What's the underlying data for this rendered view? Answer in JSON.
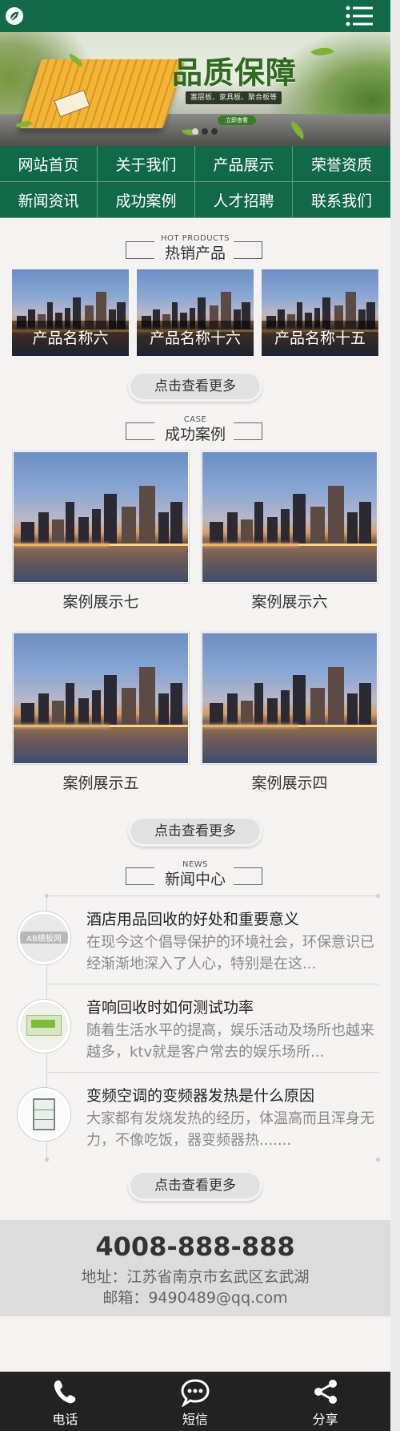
{
  "header": {
    "logo_icon": "leaf-logo-icon",
    "menu_icon": "menu-list-icon"
  },
  "banner": {
    "title": "品质保障",
    "subtitle": "塞层板、家具板、聚合板等",
    "button_label": "立即查看",
    "active_slide": 2,
    "slide_count": 3
  },
  "nav": {
    "items": [
      "网站首页",
      "关于我们",
      "产品展示",
      "荣誉资质",
      "新闻资讯",
      "成功案例",
      "人才招聘",
      "联系我们"
    ]
  },
  "hot_products": {
    "heading_en": "HOT PRODUCTS",
    "heading": "热销产品",
    "items": [
      "产品名称六",
      "产品名称十六",
      "产品名称十五"
    ],
    "more_label": "点击查看更多"
  },
  "cases": {
    "heading_en": "CASE",
    "heading": "成功案例",
    "items": [
      "案例展示七",
      "案例展示六",
      "案例展示五",
      "案例展示四"
    ],
    "more_label": "点击查看更多"
  },
  "news": {
    "heading_en": "NEWS",
    "heading": "新闻中心",
    "items": [
      {
        "title": "酒店用品回收的好处和重要意义",
        "desc": "在现今这个倡导保护的环境社会，环保意识已经渐渐地深入了人心，特别是在这...",
        "thumb": "AB模板网"
      },
      {
        "title": "音响回收时如何测试功率",
        "desc": "随着生活水平的提高，娱乐活动及场所也越来越多，ktv就是客户常去的娱乐场所...",
        "thumb": ""
      },
      {
        "title": "变频空调的变频器发热是什么原因",
        "desc": "大家都有发烧发热的经历，体温高而且浑身无力，不像吃饭，器变频器热.......",
        "thumb": ""
      }
    ],
    "more_label": "点击查看更多"
  },
  "footer": {
    "phone": "4008-888-888",
    "address": "地址：江苏省南京市玄武区玄武湖",
    "email": "邮箱：9490489@qq.com"
  },
  "bottom_bar": {
    "items": [
      {
        "label": "电话",
        "icon": "phone-icon"
      },
      {
        "label": "短信",
        "icon": "message-icon"
      },
      {
        "label": "分享",
        "icon": "share-icon"
      }
    ]
  },
  "colors": {
    "brand_green": "#12694a",
    "footer_bg": "#dcdcdc",
    "bottom_bar_bg": "#222222"
  }
}
